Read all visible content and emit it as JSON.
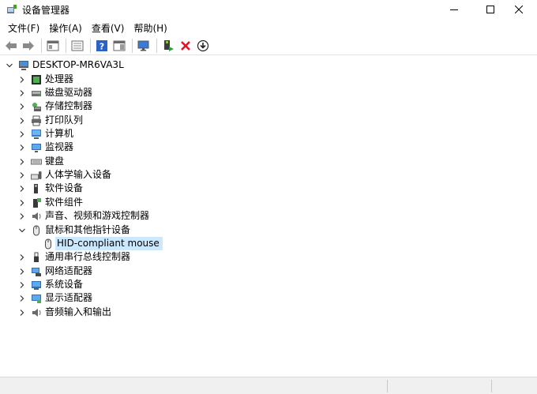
{
  "window": {
    "title": "设备管理器",
    "icon": "device-manager-icon"
  },
  "menu": [
    "文件(F)",
    "操作(A)",
    "查看(V)",
    "帮助(H)"
  ],
  "toolbar": {
    "buttons": [
      "back-arrow-icon",
      "forward-arrow-icon",
      "properties-panel-icon",
      "console-tree-icon",
      "help-icon",
      "action-pane-icon",
      "scan-hardware-icon",
      "update-driver-icon",
      "uninstall-device-icon",
      "download-driver-icon"
    ]
  },
  "tree": {
    "root": "DESKTOP-MR6VA3L",
    "categories": [
      {
        "label": "处理器",
        "icon": "processor-icon"
      },
      {
        "label": "磁盘驱动器",
        "icon": "disk-drive-icon"
      },
      {
        "label": "存储控制器",
        "icon": "storage-controller-icon"
      },
      {
        "label": "打印队列",
        "icon": "printer-icon"
      },
      {
        "label": "计算机",
        "icon": "computer-icon"
      },
      {
        "label": "监视器",
        "icon": "monitor-icon"
      },
      {
        "label": "键盘",
        "icon": "keyboard-icon"
      },
      {
        "label": "人体学输入设备",
        "icon": "hid-icon"
      },
      {
        "label": "软件设备",
        "icon": "software-device-icon"
      },
      {
        "label": "软件组件",
        "icon": "software-component-icon"
      },
      {
        "label": "声音、视频和游戏控制器",
        "icon": "audio-icon"
      },
      {
        "label": "鼠标和其他指针设备",
        "icon": "mouse-icon",
        "expanded": true,
        "children": [
          "HID-compliant mouse"
        ]
      },
      {
        "label": "通用串行总线控制器",
        "icon": "usb-icon"
      },
      {
        "label": "网络适配器",
        "icon": "network-adapter-icon"
      },
      {
        "label": "系统设备",
        "icon": "system-device-icon"
      },
      {
        "label": "显示适配器",
        "icon": "display-adapter-icon"
      },
      {
        "label": "音频输入和输出",
        "icon": "audio-io-icon"
      }
    ]
  },
  "colors": {
    "selection": "#cce8ff",
    "delete_red": "#e81123"
  }
}
